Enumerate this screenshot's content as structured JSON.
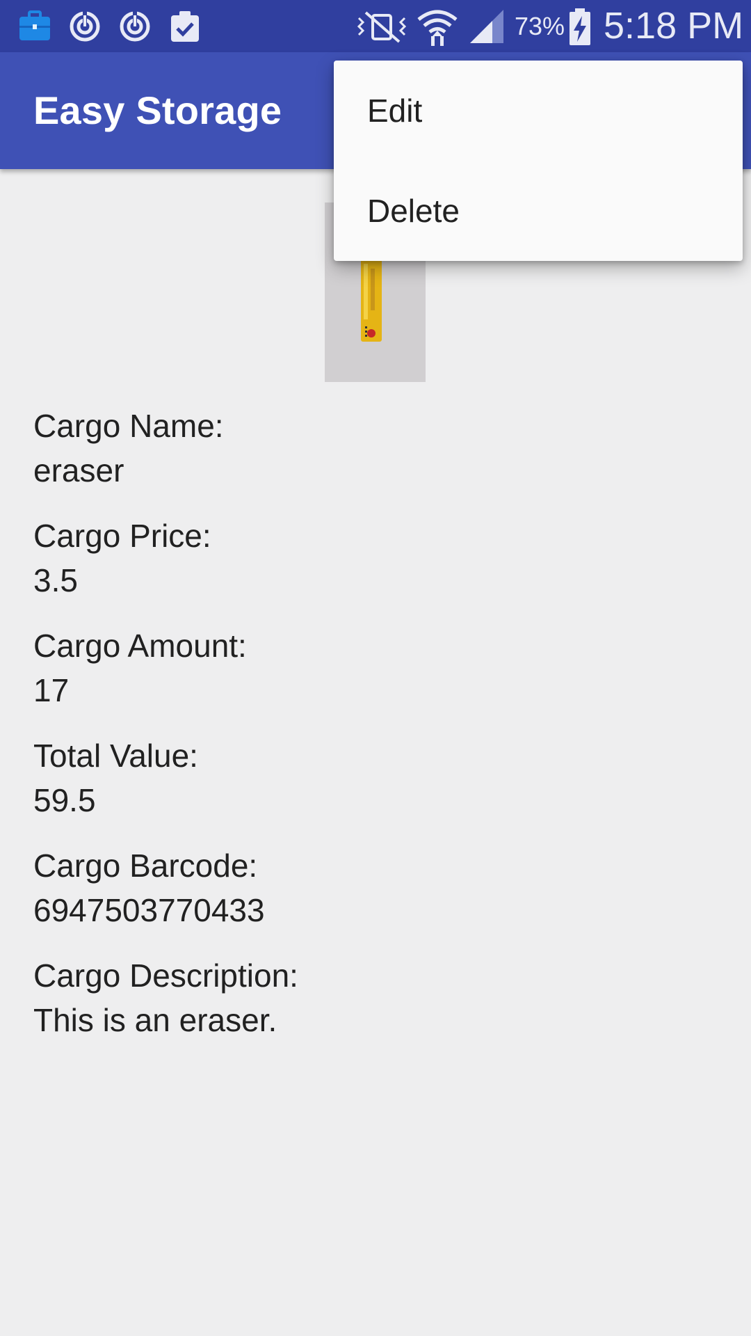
{
  "status_bar": {
    "icons": [
      "briefcase-icon",
      "sync-icon",
      "sync-icon",
      "clipboard-check-icon",
      "vibrate-mute-icon",
      "wifi-icon",
      "cell-signal-icon",
      "battery-charging-icon"
    ],
    "battery_percent": "73%",
    "time": "5:18 PM",
    "colors": {
      "background": "#303f9f",
      "foreground": "#e8eaf6",
      "briefcase_accent": "#1e88e5"
    }
  },
  "app_bar": {
    "title": "Easy Storage",
    "colors": {
      "background": "#3f51b5",
      "title": "#ffffff"
    }
  },
  "overflow_menu": {
    "items": [
      {
        "label": "Edit"
      },
      {
        "label": "Delete"
      }
    ]
  },
  "cargo": {
    "image": "eraser-photo",
    "fields": [
      {
        "label": "Cargo Name:",
        "value": "eraser"
      },
      {
        "label": "Cargo Price:",
        "value": "3.5"
      },
      {
        "label": "Cargo Amount:",
        "value": "17"
      },
      {
        "label": "Total Value:",
        "value": "59.5"
      },
      {
        "label": "Cargo Barcode:",
        "value": "6947503770433"
      },
      {
        "label": "Cargo Description:",
        "value": "This is an eraser."
      }
    ]
  }
}
